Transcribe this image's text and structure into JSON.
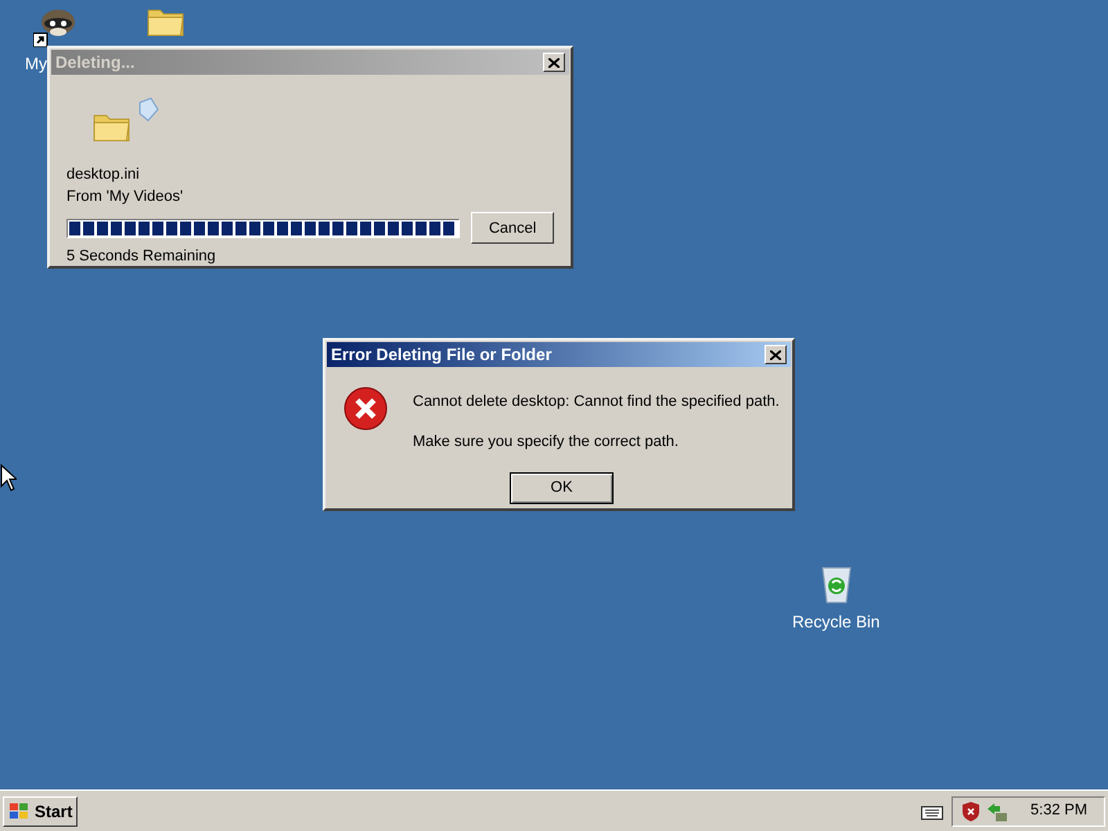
{
  "desktop_icons": [
    {
      "kind": "raccoon",
      "label": "My"
    },
    {
      "kind": "folder"
    },
    {
      "kind": "recycle",
      "label": "Recycle Bin"
    }
  ],
  "progress_dialog": {
    "title": "Deleting...",
    "active": false,
    "file": "desktop.ini",
    "source": "From 'My Videos'",
    "level": 1,
    "remaining": "5 Seconds Remaining",
    "button": "Cancel"
  },
  "error_dialog": {
    "title": "Error Deleting File or Folder",
    "active": true,
    "message": "Cannot delete desktop: Cannot find the specified path.",
    "hint": "Make sure you specify the correct path.",
    "button": "OK"
  },
  "taskbar": {
    "start": "Start",
    "clock": "5:32 PM"
  }
}
